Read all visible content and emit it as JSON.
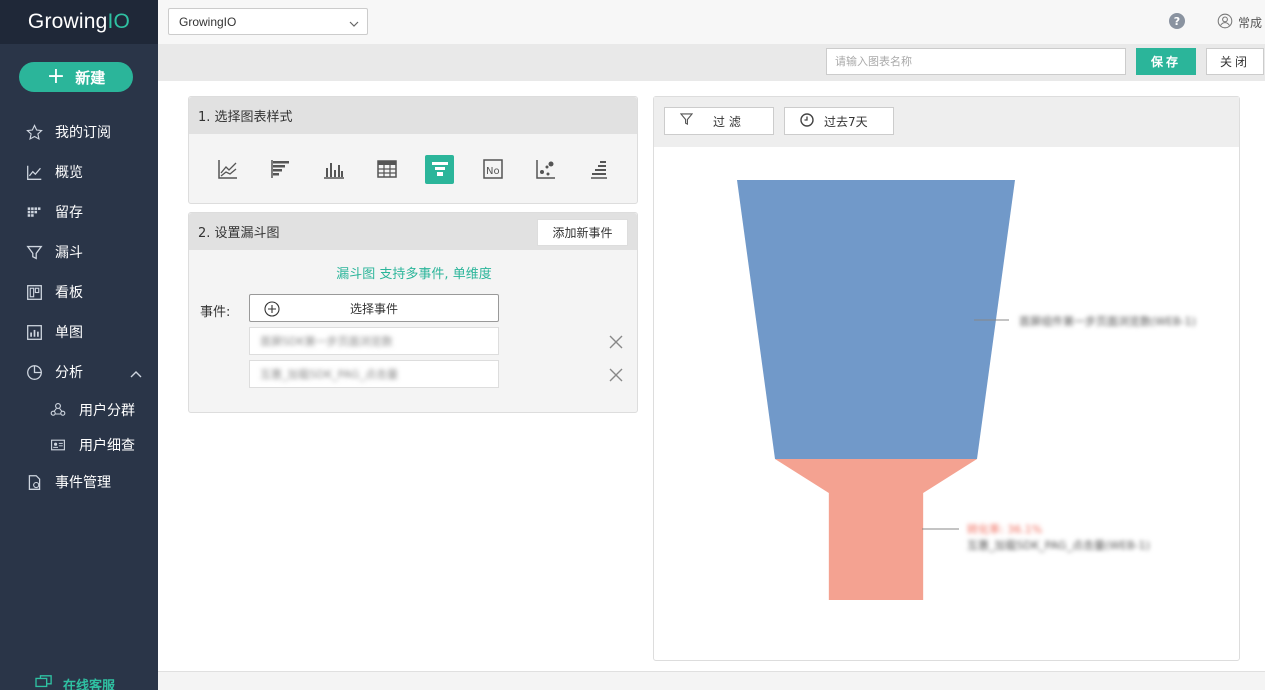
{
  "sidebar": {
    "logo_main": "Growing",
    "logo_accent": "IO",
    "new_label": "新建",
    "items": [
      {
        "label": "我的订阅",
        "icon": "star-icon"
      },
      {
        "label": "概览",
        "icon": "line-chart-icon"
      },
      {
        "label": "留存",
        "icon": "retention-icon"
      },
      {
        "label": "漏斗",
        "icon": "funnel-icon"
      },
      {
        "label": "看板",
        "icon": "dashboard-icon"
      },
      {
        "label": "单图",
        "icon": "single-chart-icon"
      },
      {
        "label": "分析",
        "icon": "pie-icon",
        "expanded": true
      }
    ],
    "sub_items": [
      {
        "label": "用户分群",
        "icon": "user-group-icon"
      },
      {
        "label": "用户细查",
        "icon": "user-card-icon"
      }
    ],
    "event_mgmt": {
      "label": "事件管理",
      "icon": "event-doc-icon"
    },
    "support_label": "在线客服"
  },
  "topbar": {
    "project": "GrowingIO",
    "help": "?",
    "user": "常成"
  },
  "actionbar": {
    "name_placeholder": "请输入图表名称",
    "save_label": "保存",
    "close_label": "关闭"
  },
  "panel1": {
    "title": "1. 选择图表样式",
    "chart_types": [
      "line",
      "horizontal-bar",
      "vertical-bar",
      "table",
      "funnel",
      "number",
      "scatter",
      "stacked-bar"
    ],
    "selected": "funnel"
  },
  "panel2": {
    "title": "2. 设置漏斗图",
    "add_event_label": "添加新事件",
    "hint": "漏斗图 支持多事件, 单维度",
    "event_label": "事件:",
    "select_event_label": "选择事件",
    "events": [
      "首屏SDK第一步页面浏览数",
      "互惠_加载SDK_PAG_点击量"
    ]
  },
  "chart_panel": {
    "filter_label": "过 滤",
    "time_label": "过去7天",
    "colors": {
      "stage1": "#7199c9",
      "stage2": "#f4a291"
    },
    "labels": {
      "stage1": "首屏组件第一步页面浏览数(WEB-1)",
      "stage2_rate": "转化率: 36.1%",
      "stage2": "互惠_加载SDK_PAG_点击量(WEB-1)"
    }
  },
  "chart_data": {
    "type": "funnel",
    "series": [
      {
        "stage": "首屏组件第一步页面浏览数(WEB-1)",
        "relative": 1.0
      },
      {
        "stage": "互惠_加载SDK_PAG_点击量(WEB-1)",
        "relative": 0.361,
        "conversion_label": "转化率: 36.1%"
      }
    ]
  }
}
